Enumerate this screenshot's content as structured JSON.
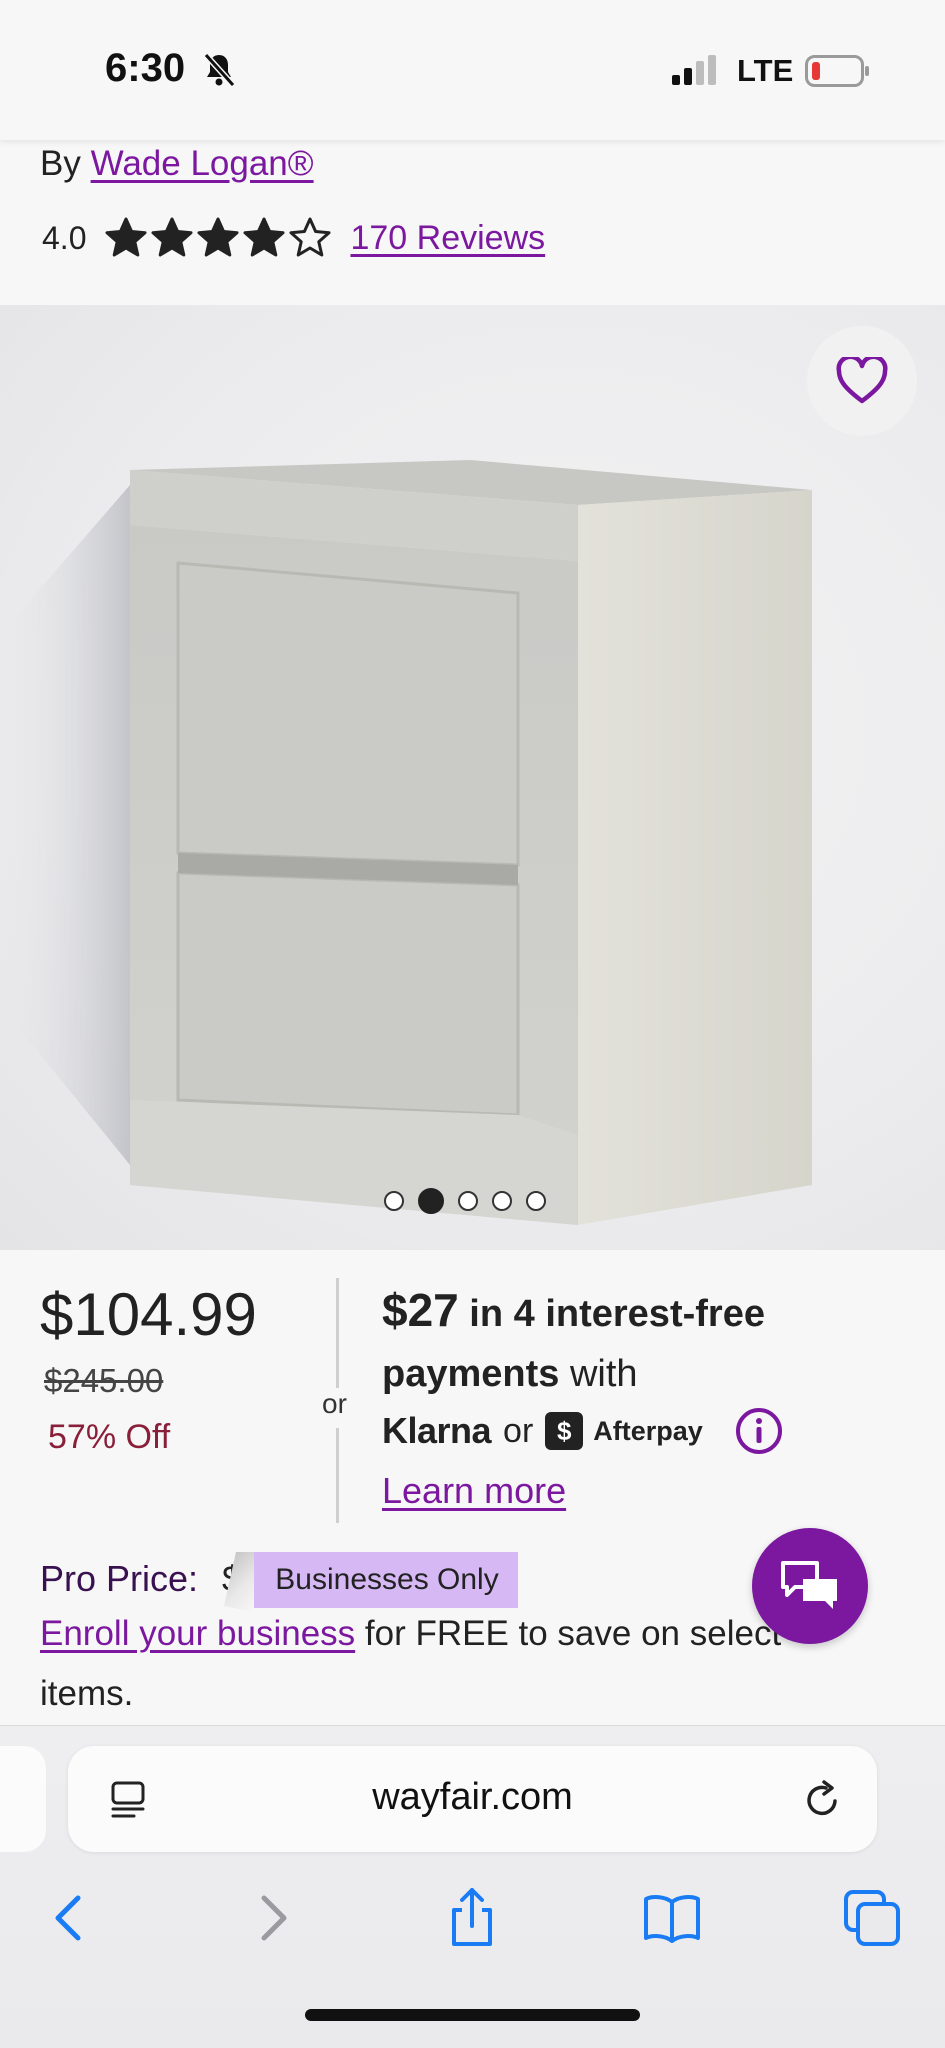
{
  "status_bar": {
    "time": "6:30",
    "network": "LTE",
    "icons": [
      "bell-slash-icon",
      "signal-icon",
      "battery-icon"
    ],
    "battery_color": "#e53935"
  },
  "product": {
    "brand_prefix": "By",
    "brand": "Wade Logan®",
    "rating": "4.0",
    "stars_filled": 4,
    "stars_total": 5,
    "reviews_label": "170 Reviews",
    "carousel": {
      "count": 5,
      "active_index": 1
    }
  },
  "pricing": {
    "price": "$104.99",
    "was_price": "$245.00",
    "discount": "57% Off",
    "or": "or",
    "installment_amount": "$27",
    "installment_text_1": " in 4 interest-free",
    "installment_text_2_bold": "payments",
    "installment_text_2": " with",
    "klarna": "Klarna",
    "providers_or": "or",
    "afterpay_badge": "$",
    "afterpay": "Afterpay",
    "learn_more": "Learn more"
  },
  "pro": {
    "label": "Pro Price:",
    "dollar": "$",
    "badge": "Businesses Only",
    "enroll_link": "Enroll your business",
    "enroll_text": " for FREE to save on select",
    "enroll_text_2": "items."
  },
  "browser": {
    "url": "wayfair.com",
    "nav_icons": [
      "back-icon",
      "forward-icon",
      "share-icon",
      "bookmarks-icon",
      "tabs-icon"
    ]
  },
  "colors": {
    "accent": "#7b189f",
    "discount": "#8a1f3a",
    "badge": "#d6b8f5",
    "ios_blue": "#1a7cf5"
  }
}
